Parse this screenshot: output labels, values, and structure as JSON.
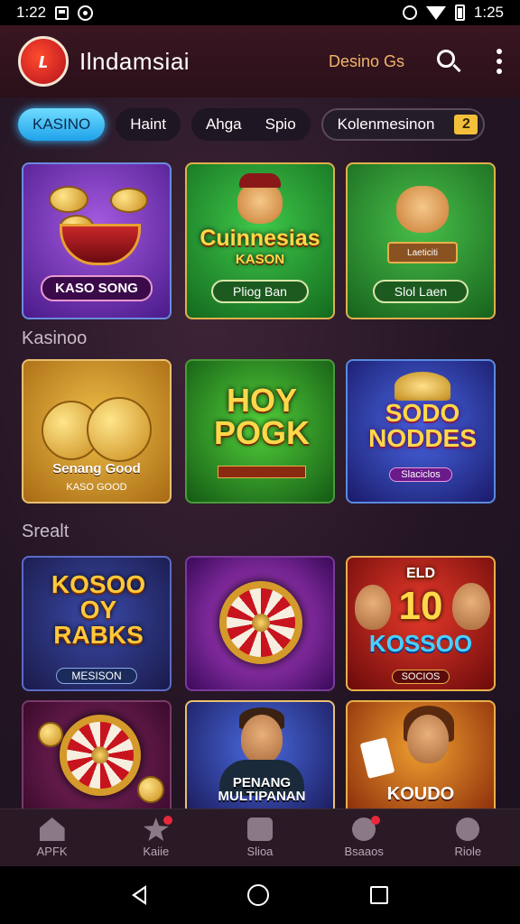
{
  "status_bar": {
    "time_left": "1:22",
    "time_right": "1:25"
  },
  "header": {
    "logo_text": "ʟ",
    "title": "Ilndamsiai",
    "casino_label": "Desino Gs"
  },
  "tabs": [
    {
      "label": "KASINO"
    },
    {
      "label": "Haint"
    },
    {
      "label": "Ahga",
      "label2": "Spio"
    },
    {
      "label": "Kolenmesinon",
      "badge": "2"
    }
  ],
  "sections": {
    "first": "Kasinoo",
    "second": "Srealt"
  },
  "cards": [
    {
      "title": "",
      "subtitle": "KASO SONG"
    },
    {
      "title": "Cuinnesias",
      "title2": "KASON",
      "subtitle": "Pliog Ban"
    },
    {
      "title": "",
      "sign": "Laeticiti",
      "subtitle": "Slol Laen"
    },
    {
      "title": "Senang Good",
      "subtitle": "KASO GOOD"
    },
    {
      "title": "HOY POGK",
      "subtitle": ""
    },
    {
      "title": "SODO NODDES",
      "subtitle": "Slaciclos"
    },
    {
      "title": "KOSOO OY RABKS",
      "subtitle": "MESISON"
    },
    {
      "title": "",
      "subtitle": ""
    },
    {
      "title": "10",
      "top": "ELD",
      "title2": "KOSSOO",
      "subtitle": "SOCIOS"
    },
    {
      "title": "",
      "subtitle": ""
    },
    {
      "title": "PENANG MULTIPANAN",
      "subtitle": ""
    },
    {
      "title": "KOUDO",
      "subtitle": ""
    }
  ],
  "bottom_nav": [
    {
      "label": "APFK",
      "icon": "home-icon"
    },
    {
      "label": "Kaiie",
      "icon": "star-icon"
    },
    {
      "label": "Slioa",
      "icon": "shop-icon"
    },
    {
      "label": "Bsaaos",
      "icon": "gear-icon"
    },
    {
      "label": "Riole",
      "icon": "profile-icon"
    }
  ]
}
